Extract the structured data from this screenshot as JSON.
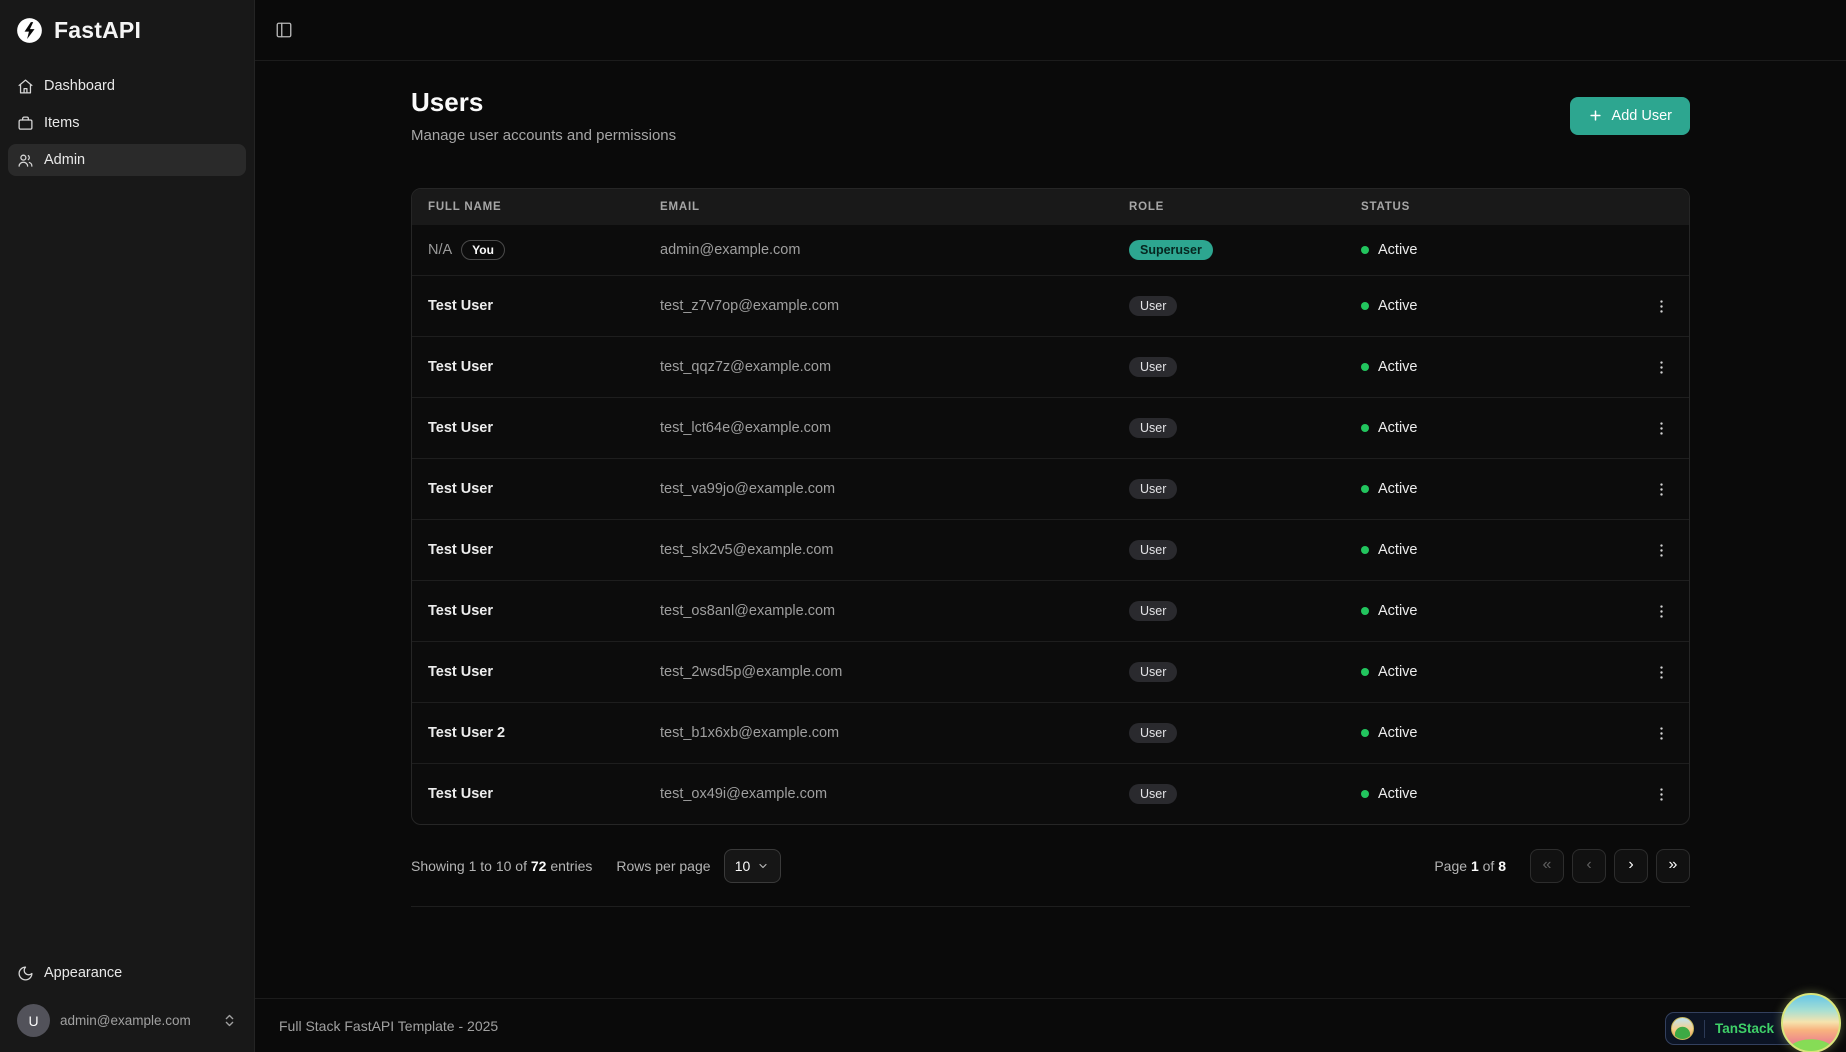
{
  "sidebar": {
    "brand": "FastAPI",
    "nav": [
      {
        "label": "Dashboard",
        "icon": "home-icon",
        "active": false
      },
      {
        "label": "Items",
        "icon": "briefcase-icon",
        "active": false
      },
      {
        "label": "Admin",
        "icon": "users-icon",
        "active": true
      }
    ],
    "appearance_label": "Appearance",
    "user": {
      "initial": "U",
      "email": "admin@example.com"
    }
  },
  "header": {
    "title": "Users",
    "subtitle": "Manage user accounts and permissions",
    "add_user_label": "Add User"
  },
  "table": {
    "columns": [
      "Full Name",
      "Email",
      "Role",
      "Status"
    ],
    "you_badge_label": "You",
    "rows": [
      {
        "name": "N/A",
        "you": true,
        "email": "admin@example.com",
        "role": "Superuser",
        "role_variant": "superuser",
        "status": "Active",
        "menu": false
      },
      {
        "name": "Test User",
        "you": false,
        "email": "test_z7v7op@example.com",
        "role": "User",
        "role_variant": "user",
        "status": "Active",
        "menu": true
      },
      {
        "name": "Test User",
        "you": false,
        "email": "test_qqz7z@example.com",
        "role": "User",
        "role_variant": "user",
        "status": "Active",
        "menu": true
      },
      {
        "name": "Test User",
        "you": false,
        "email": "test_lct64e@example.com",
        "role": "User",
        "role_variant": "user",
        "status": "Active",
        "menu": true
      },
      {
        "name": "Test User",
        "you": false,
        "email": "test_va99jo@example.com",
        "role": "User",
        "role_variant": "user",
        "status": "Active",
        "menu": true
      },
      {
        "name": "Test User",
        "you": false,
        "email": "test_slx2v5@example.com",
        "role": "User",
        "role_variant": "user",
        "status": "Active",
        "menu": true
      },
      {
        "name": "Test User",
        "you": false,
        "email": "test_os8anl@example.com",
        "role": "User",
        "role_variant": "user",
        "status": "Active",
        "menu": true
      },
      {
        "name": "Test User",
        "you": false,
        "email": "test_2wsd5p@example.com",
        "role": "User",
        "role_variant": "user",
        "status": "Active",
        "menu": true
      },
      {
        "name": "Test User 2",
        "you": false,
        "email": "test_b1x6xb@example.com",
        "role": "User",
        "role_variant": "user",
        "status": "Active",
        "menu": true
      },
      {
        "name": "Test User",
        "you": false,
        "email": "test_ox49i@example.com",
        "role": "User",
        "role_variant": "user",
        "status": "Active",
        "menu": true
      }
    ]
  },
  "pagination": {
    "showing": {
      "prefix": "Showing 1 to 10 of",
      "count": "72",
      "suffix": "entries"
    },
    "rows_per_page_label": "Rows per page",
    "rows_per_page_value": "10",
    "page": {
      "label": "Page",
      "current": "1",
      "of": "of",
      "total": "8"
    },
    "buttons": [
      {
        "name": "first-page",
        "glyph": "«",
        "enabled": false
      },
      {
        "name": "previous-page",
        "glyph": "‹",
        "enabled": false
      },
      {
        "name": "next-page",
        "glyph": "›",
        "enabled": true
      },
      {
        "name": "last-page",
        "glyph": "»",
        "enabled": true
      }
    ]
  },
  "footer": {
    "text": "Full Stack FastAPI Template - 2025"
  },
  "devtools": {
    "label": "TanStack"
  },
  "colors": {
    "accent_teal": "#2da690",
    "status_green": "#22c55e",
    "tanstack_green": "#3fd068",
    "sidebar_bg": "#181818",
    "main_bg": "#0a0a0a"
  }
}
